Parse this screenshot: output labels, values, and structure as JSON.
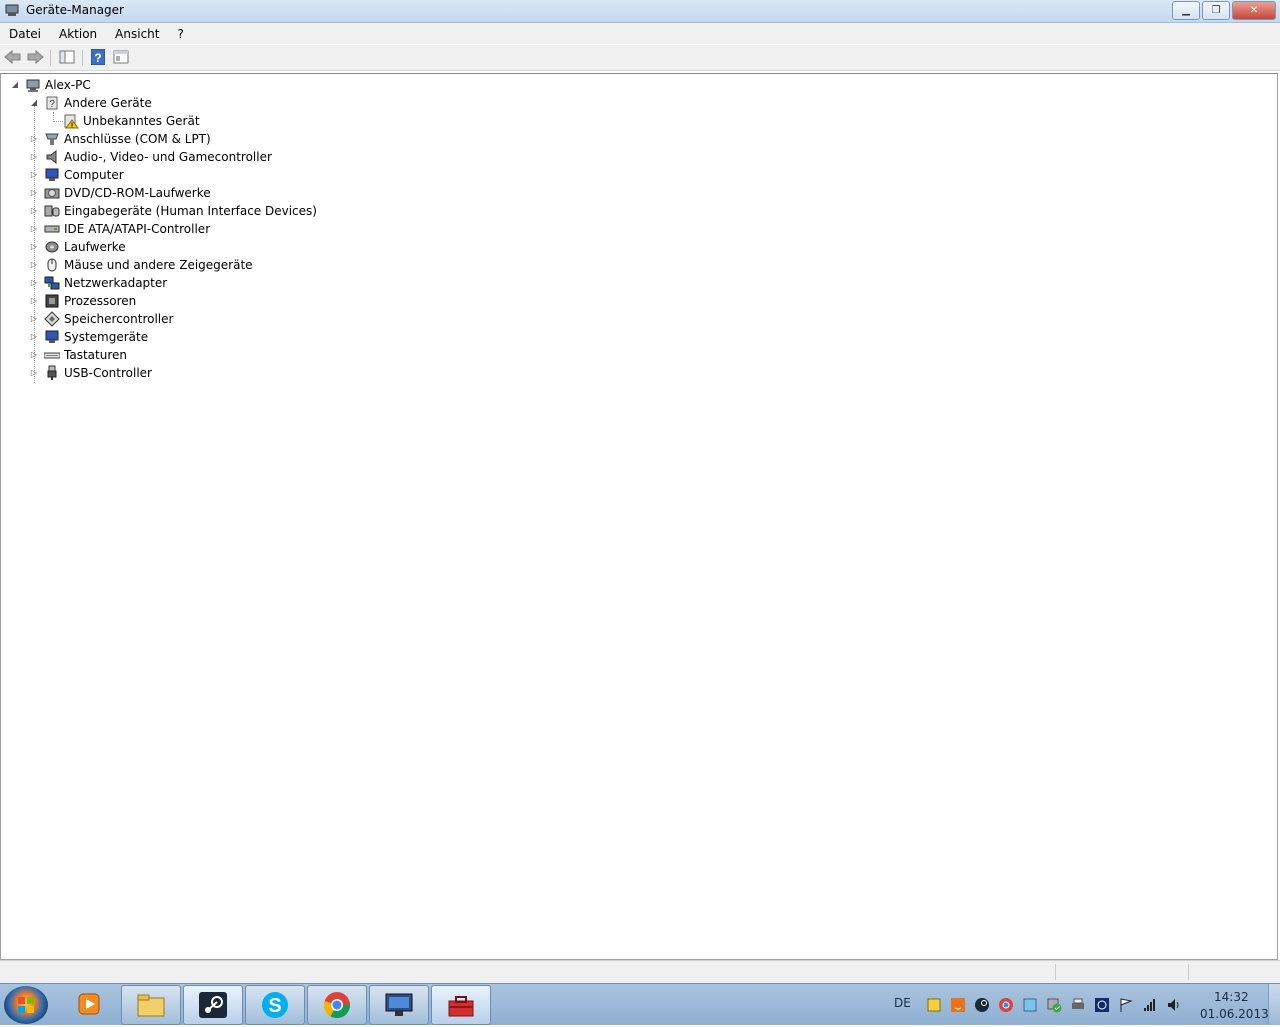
{
  "window": {
    "title": "Geräte-Manager"
  },
  "menu": [
    "Datei",
    "Aktion",
    "Ansicht",
    "?"
  ],
  "tree": {
    "root": "Alex-PC",
    "categories": [
      {
        "label": "Andere Geräte",
        "expanded": true,
        "children": [
          "Unbekanntes Gerät"
        ]
      },
      {
        "label": "Anschlüsse (COM & LPT)"
      },
      {
        "label": "Audio-, Video- und Gamecontroller"
      },
      {
        "label": "Computer"
      },
      {
        "label": "DVD/CD-ROM-Laufwerke"
      },
      {
        "label": "Eingabegeräte (Human Interface Devices)"
      },
      {
        "label": "IDE ATA/ATAPI-Controller"
      },
      {
        "label": "Laufwerke"
      },
      {
        "label": "Mäuse und andere Zeigegeräte"
      },
      {
        "label": "Netzwerkadapter"
      },
      {
        "label": "Prozessoren"
      },
      {
        "label": "Speichercontroller"
      },
      {
        "label": "Systemgeräte"
      },
      {
        "label": "Tastaturen"
      },
      {
        "label": "USB-Controller"
      }
    ]
  },
  "taskbar": {
    "language": "DE",
    "time": "14:32",
    "date": "01.06.2013"
  }
}
